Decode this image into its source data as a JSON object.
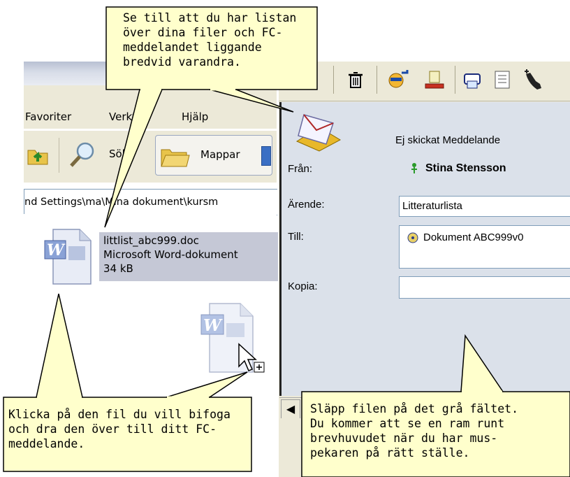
{
  "explorer": {
    "menu": [
      "Favoriter",
      "Verktyg",
      "Hjälp"
    ],
    "toolbar": {
      "search": "Sök",
      "folders": "Mappar"
    },
    "address": "nd Settings\\ma\\Mina dokument\\kursm",
    "file": {
      "name": "littlist_abc999.doc",
      "type": "Microsoft Word-dokument",
      "size": "34 kB"
    }
  },
  "message": {
    "status": "Ej skickat Meddelande",
    "from_label": "Från:",
    "from_value": "Stina Stensson",
    "subject_label": "Ärende:",
    "subject_value": "Litteraturlista",
    "to_label": "Till:",
    "to_value": "Dokument ABC999v0",
    "cc_label": "Kopia:",
    "cc_value": ""
  },
  "callouts": {
    "top": [
      "Se till att du har listan",
      "över dina filer och FC-",
      "meddelandet liggande",
      "bredvid varandra."
    ],
    "bottom_left": [
      "Klicka på den fil du vill bifoga",
      "och dra den över till ditt FC-",
      "meddelande."
    ],
    "bottom_right": [
      "Släpp filen på det grå fältet.",
      "Du kommer att se en ram runt",
      "brevhuvudet när du har mus-",
      "pekaren på rätt ställe."
    ]
  },
  "icons": [
    "word-document-icon",
    "envelope-icon",
    "delete-icon",
    "person-icon",
    "drag-copy-cursor-icon"
  ]
}
